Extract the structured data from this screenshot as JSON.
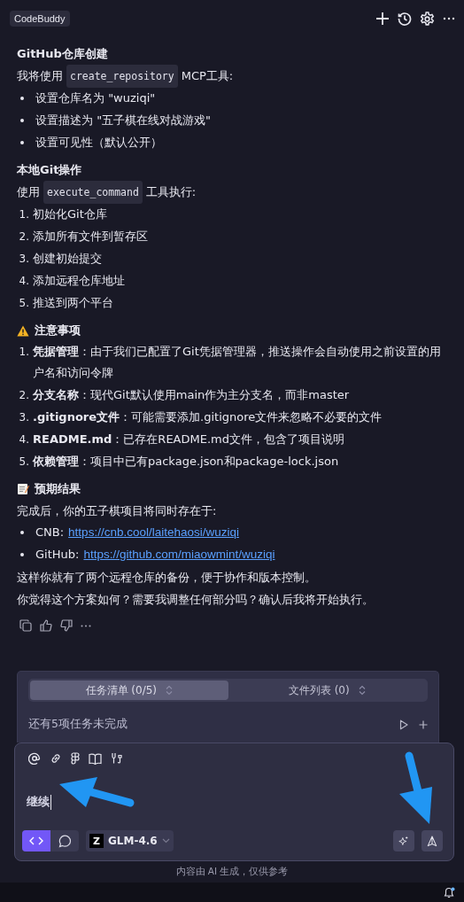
{
  "header": {
    "app_name": "CodeBuddy"
  },
  "message": {
    "sections": [
      {
        "kind": "heading",
        "text": "GitHub仓库创建"
      },
      {
        "kind": "paragraph",
        "parts": [
          {
            "kind": "text",
            "text": "我将使用"
          },
          {
            "kind": "code",
            "text": "create_repository"
          },
          {
            "kind": "text",
            "text": "MCP工具:"
          }
        ]
      },
      {
        "kind": "bullets",
        "items": [
          "设置仓库名为 \"wuziqi\"",
          "设置描述为 \"五子棋在线对战游戏\"",
          "设置可见性（默认公开）"
        ]
      },
      {
        "kind": "heading",
        "text": "本地Git操作"
      },
      {
        "kind": "paragraph",
        "parts": [
          {
            "kind": "text",
            "text": "使用"
          },
          {
            "kind": "code",
            "text": "execute_command"
          },
          {
            "kind": "text",
            "text": "工具执行:"
          }
        ]
      },
      {
        "kind": "numbered",
        "items": [
          {
            "number": "1.",
            "text": "初始化Git仓库"
          },
          {
            "number": "2.",
            "text": "添加所有文件到暂存区"
          },
          {
            "number": "3.",
            "text": "创建初始提交"
          },
          {
            "number": "4.",
            "text": "添加远程仓库地址"
          },
          {
            "number": "5.",
            "text": "推送到两个平台"
          }
        ]
      },
      {
        "kind": "warning_heading",
        "text": "注意事项"
      },
      {
        "kind": "numbered",
        "items": [
          {
            "number": "1.",
            "text": "**凭据管理**：由于我们已配置了Git凭据管理器，推送操作会自动使用之前设置的用户名和访问令牌"
          },
          {
            "number": "2.",
            "text": "**分支名称**：现代Git默认使用main作为主分支名，而非master"
          },
          {
            "number": "3.",
            "text": "**.gitignore文件**：可能需要添加.gitignore文件来忽略不必要的文件"
          },
          {
            "number": "4.",
            "text": "**README.md**：已存在README.md文件，包含了项目说明"
          },
          {
            "number": "5.",
            "text": "**依赖管理**：项目中已有package.json和package-lock.json"
          }
        ]
      },
      {
        "kind": "memo_heading",
        "text": "预期结果"
      },
      {
        "kind": "paragraph",
        "parts": [
          {
            "kind": "text",
            "text": "完成后，你的五子棋项目将同时存在于:"
          }
        ]
      },
      {
        "kind": "link_bullets",
        "items": [
          {
            "label": "CNB:",
            "url": "https://cnb.cool/laitehaosi/wuziqi"
          },
          {
            "label": "GitHub:",
            "url": "https://github.com/miaowmint/wuziqi"
          }
        ]
      },
      {
        "kind": "paragraph",
        "parts": [
          {
            "kind": "text",
            "text": "这样你就有了两个远程仓库的备份，便于协作和版本控制。"
          }
        ]
      },
      {
        "kind": "paragraph",
        "parts": [
          {
            "kind": "text",
            "text": "你觉得这个方案如何？需要我调整任何部分吗？确认后我将开始执行。"
          }
        ]
      }
    ]
  },
  "task_panel": {
    "tabs": [
      {
        "label": "任务清单 (0/5)",
        "selected": true
      },
      {
        "label": "文件列表 (0)",
        "selected": false
      }
    ],
    "status": "还有5项任务未完成"
  },
  "composer": {
    "value": "继续",
    "modes": [
      {
        "kind": "code",
        "selected": true
      },
      {
        "kind": "chat",
        "selected": false
      }
    ],
    "model_logo": "Z",
    "model": "GLM-4.6"
  },
  "disclaimer": "内容由 AI 生成，仅供参考"
}
